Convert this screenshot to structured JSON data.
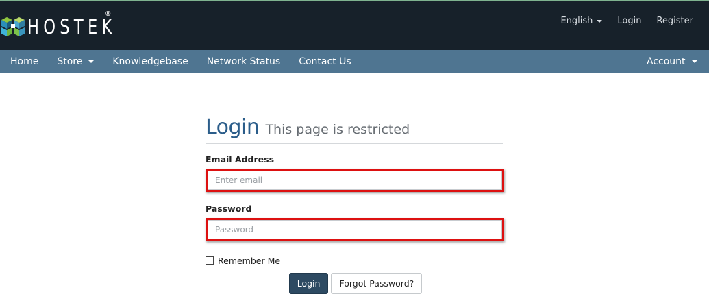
{
  "brand": {
    "name": "HOSTEK",
    "registered_mark": "®",
    "colors": {
      "header_bg": "#17212a",
      "nav_bg": "#4f7591",
      "title": "#2b5d8a",
      "highlight": "#dd1111"
    }
  },
  "top_links": {
    "language": "English",
    "login": "Login",
    "register": "Register"
  },
  "nav": {
    "items": [
      {
        "label": "Home"
      },
      {
        "label": "Store"
      },
      {
        "label": "Knowledgebase"
      },
      {
        "label": "Network Status"
      },
      {
        "label": "Contact Us"
      }
    ],
    "account": "Account"
  },
  "login": {
    "title": "Login",
    "subtitle": "This page is restricted",
    "email_label": "Email Address",
    "email_placeholder": "Enter email",
    "email_value": "",
    "password_label": "Password",
    "password_placeholder": "Password",
    "password_value": "",
    "remember_label": "Remember Me",
    "remember_checked": false,
    "submit_label": "Login",
    "forgot_label": "Forgot Password?"
  }
}
